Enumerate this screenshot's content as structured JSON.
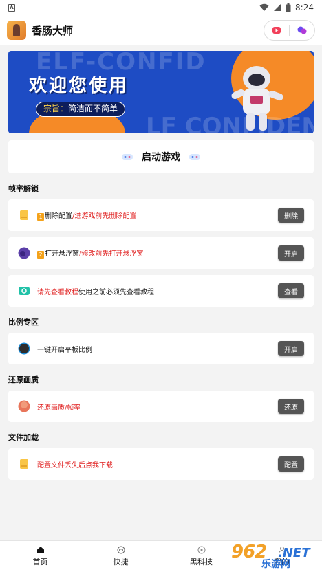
{
  "status_bar": {
    "sim_label": "A",
    "time": "8:24"
  },
  "app": {
    "title": "香肠大师"
  },
  "banner": {
    "headline": "欢迎您使用",
    "tagline_prefix": "宗旨：",
    "tagline_text": "简洁而不简单",
    "watermark_top": "ELF-CONFID",
    "watermark_bottom": "LF CONFIDEN"
  },
  "start_button": {
    "label": "启动游戏"
  },
  "sections": [
    {
      "title": "帧率解锁",
      "rows": [
        {
          "icon": "folder-icon",
          "badge": "1",
          "strong": "删除配置",
          "note": "/进游戏前先删除配置",
          "button": "删除"
        },
        {
          "icon": "purple-circle-icon",
          "badge": "2",
          "strong": "打开悬浮窗",
          "note": "/修改前先打开悬浮窗",
          "button": "开启"
        },
        {
          "icon": "teal-chat-icon",
          "strong_red": "请先查看教程",
          "note_dark": "使用之前必须先查看教程",
          "button": "查看"
        }
      ]
    },
    {
      "title": "比例专区",
      "rows": [
        {
          "icon": "dark-circle-icon",
          "strong": "一键开启平板比例",
          "button": "开启"
        }
      ]
    },
    {
      "title": "还原画质",
      "rows": [
        {
          "icon": "orange-circle-icon",
          "note": "还原画质/帧率",
          "button": "还原"
        }
      ]
    },
    {
      "title": "文件加载",
      "rows": [
        {
          "icon": "folder-icon",
          "note": "配置文件丢失后点我下载",
          "button": "配置"
        }
      ]
    }
  ],
  "bottom_nav": [
    {
      "label": "首页",
      "icon": "home-icon"
    },
    {
      "label": "快捷",
      "icon": "gamepad-icon"
    },
    {
      "label": "黑科技",
      "icon": "compass-icon"
    },
    {
      "label": "我的",
      "icon": "user-icon"
    }
  ],
  "watermark": {
    "number": "962",
    "domain": ".NET",
    "sub": "乐游网"
  }
}
